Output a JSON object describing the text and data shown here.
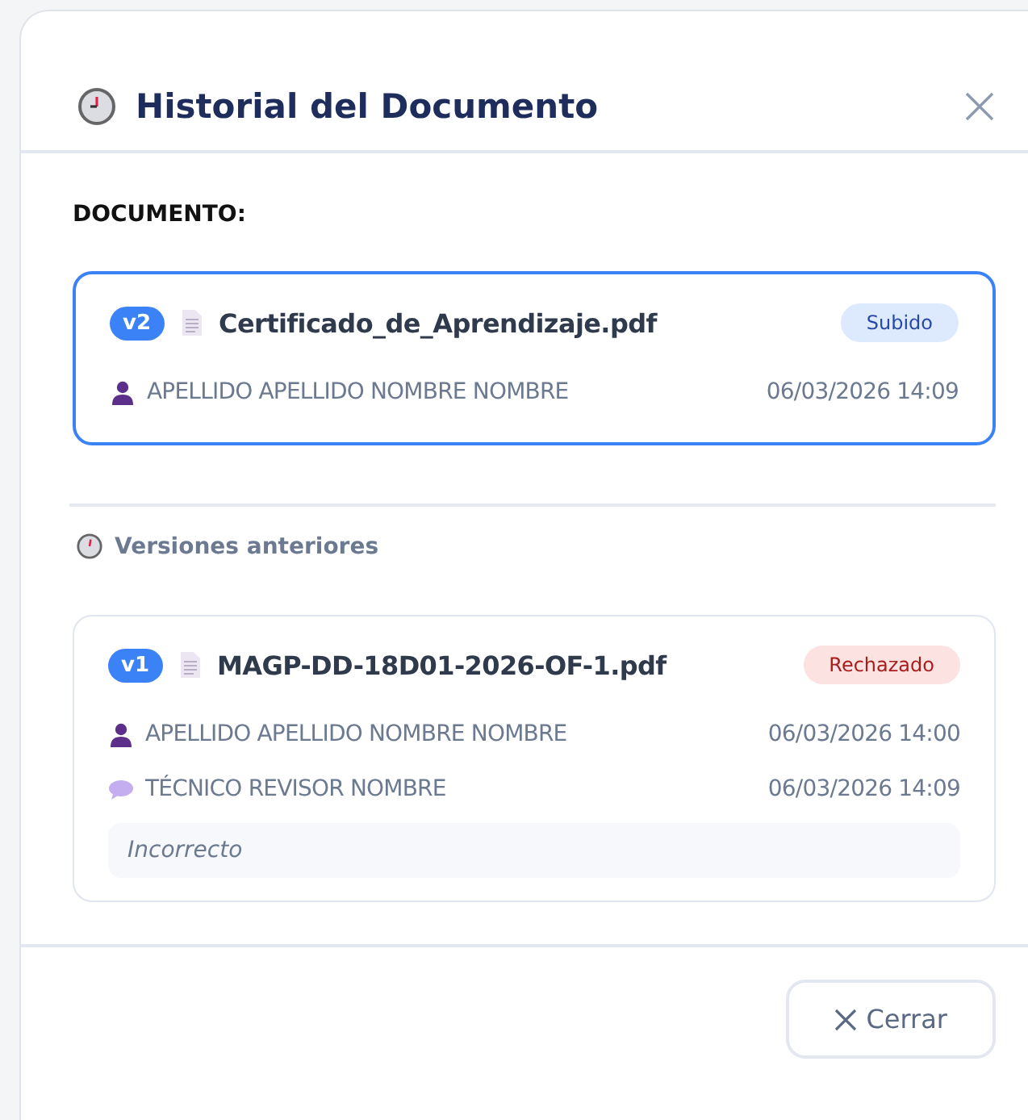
{
  "dialog": {
    "title": "Historial del Documento",
    "section_label": "DOCUMENTO:",
    "previous_label": "Versiones anteriores",
    "close_button": "Cerrar"
  },
  "current": {
    "version": "v2",
    "file": "Certificado_de_Aprendizaje.pdf",
    "status": {
      "label": "Subido",
      "kind": "uploaded"
    },
    "events": [
      {
        "kind": "uploader",
        "name": "APELLIDO APELLIDO NOMBRE NOMBRE",
        "time": "06/03/2026 14:09"
      }
    ]
  },
  "previous": [
    {
      "version": "v1",
      "file": "MAGP-DD-18D01-2026-OF-1.pdf",
      "status": {
        "label": "Rechazado",
        "kind": "rejected"
      },
      "events": [
        {
          "kind": "uploader",
          "name": "APELLIDO APELLIDO NOMBRE NOMBRE",
          "time": "06/03/2026 14:00"
        },
        {
          "kind": "reviewer",
          "name": "TÉCNICO REVISOR NOMBRE",
          "time": "06/03/2026 14:09"
        }
      ],
      "comment": "Incorrecto"
    }
  ]
}
